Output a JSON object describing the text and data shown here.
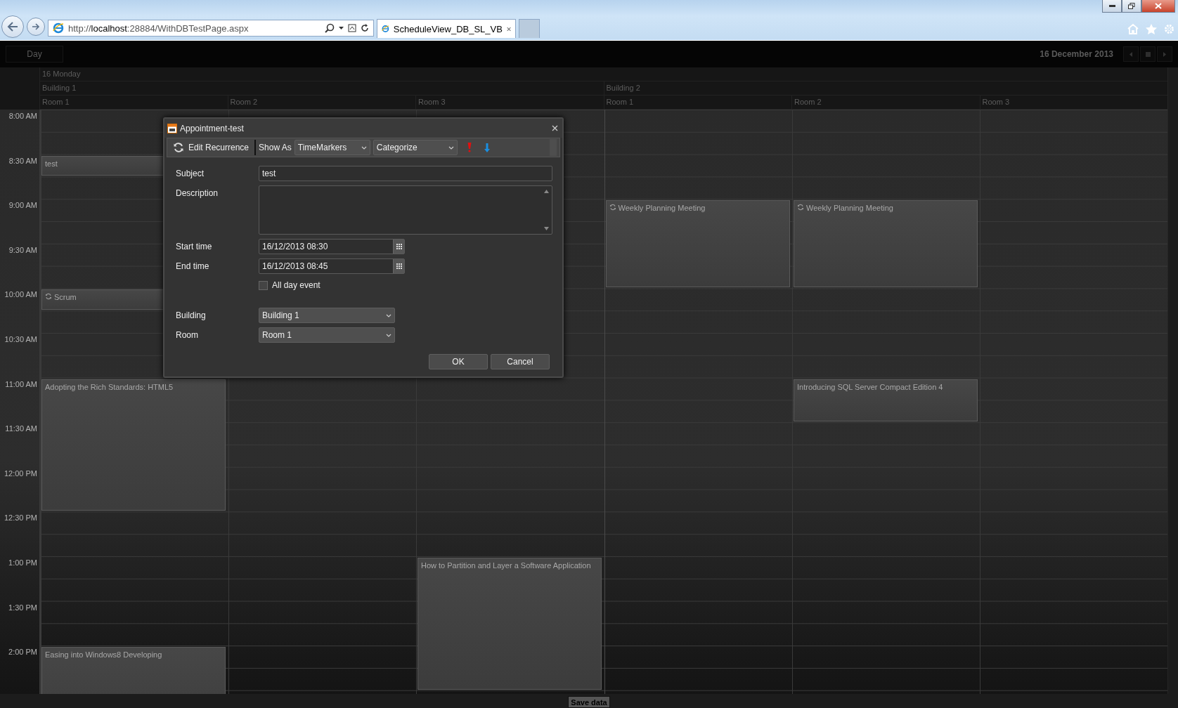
{
  "browser": {
    "address": "http://**localhost**:28884/WithDBTestPage.aspx",
    "tab_title": "ScheduleView_DB_SL_VB"
  },
  "toolbar": {
    "view_button": "Day",
    "date": "16 December 2013"
  },
  "header": {
    "day": "16 Monday",
    "buildings": [
      {
        "name": "Building 1",
        "rooms": [
          "Room 1",
          "Room 2",
          "Room 3"
        ]
      },
      {
        "name": "Building 2",
        "rooms": [
          "Room 1",
          "Room 2",
          "Room 3"
        ]
      }
    ]
  },
  "time_slots": [
    "8:00 AM",
    "8:30 AM",
    "9:00 AM",
    "9:30 AM",
    "10:00 AM",
    "10:30 AM",
    "11:00 AM",
    "11:30 AM",
    "12:00 PM",
    "12:30 PM",
    "1:00 PM",
    "1:30 PM",
    "2:00 PM"
  ],
  "appointments": [
    {
      "title": "test",
      "recurring": false
    },
    {
      "title": "Scrum",
      "recurring": true
    },
    {
      "title": "Weekly Planning Meeting",
      "recurring": true
    },
    {
      "title": "Weekly Planning Meeting",
      "recurring": true
    },
    {
      "title": "Adopting the Rich Standards: HTML5",
      "recurring": false
    },
    {
      "title": "Introducing SQL Server Compact Edition 4",
      "recurring": false
    },
    {
      "title": "How to Partition and Layer a Software Application",
      "recurring": false
    },
    {
      "title": "Easing into Windows8 Developing",
      "recurring": false
    }
  ],
  "dialog": {
    "title": "Appointment-test",
    "toolbar": {
      "edit_recurrence": "Edit Recurrence",
      "show_as_label": "Show As",
      "show_as_value": "TimeMarkers",
      "categorize": "Categorize"
    },
    "labels": {
      "subject": "Subject",
      "description": "Description",
      "start_time": "Start time",
      "end_time": "End time",
      "building": "Building",
      "room": "Room"
    },
    "subject": "test",
    "start_time": "16/12/2013 08:30",
    "end_time": "16/12/2013 08:45",
    "all_day": {
      "label": "All day event",
      "checked": false
    },
    "building": "Building 1",
    "room": "Room 1",
    "buttons": [
      "OK",
      "Cancel"
    ]
  },
  "footer": {
    "save_button": "Save data"
  }
}
